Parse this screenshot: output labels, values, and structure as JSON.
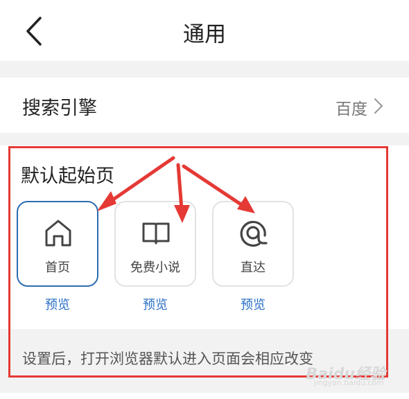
{
  "header": {
    "title": "通用",
    "back_icon": "chevron-left-icon"
  },
  "search_engine": {
    "label": "搜索引擎",
    "value": "百度"
  },
  "default_start_page": {
    "title": "默认起始页",
    "options": [
      {
        "label": "首页",
        "icon": "home-icon",
        "preview": "预览",
        "selected": true
      },
      {
        "label": "免费小说",
        "icon": "book-icon",
        "preview": "预览",
        "selected": false
      },
      {
        "label": "直达",
        "icon": "direct-icon",
        "preview": "预览",
        "selected": false
      }
    ],
    "note": "设置后，打开浏览器默认进入页面会相应改变"
  },
  "annotation": {
    "color": "#e53935"
  },
  "colors": {
    "accent": "#2a6fc7",
    "selected_border": "#2b6cb0",
    "background_gray": "#f2f2f2"
  },
  "watermark": {
    "text": "Baidu经验",
    "sub": "jingyan.baidu.com"
  }
}
